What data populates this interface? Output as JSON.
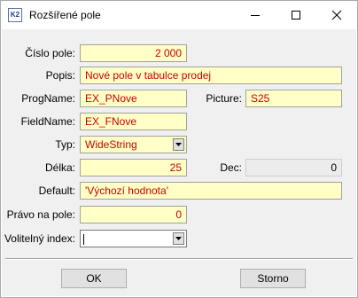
{
  "window": {
    "title": "Rozšířené pole",
    "app_icon_text": "K2"
  },
  "form": {
    "cislo_pole": {
      "label": "Číslo pole:",
      "value": "2 000"
    },
    "popis": {
      "label": "Popis:",
      "value": "Nové pole v tabulce prodej"
    },
    "progname": {
      "label": "ProgName:",
      "value": "EX_PNove"
    },
    "picture": {
      "label": "Picture:",
      "value": "S25"
    },
    "fieldname": {
      "label": "FieldName:",
      "value": "EX_FNove"
    },
    "typ": {
      "label": "Typ:",
      "value": "WideString"
    },
    "delka": {
      "label": "Délka:",
      "value": "25"
    },
    "dec": {
      "label": "Dec:",
      "value": "0"
    },
    "default": {
      "label": "Default:",
      "value": "'Výchozí hodnota'"
    },
    "pravo": {
      "label": "Právo na pole:",
      "value": "0"
    },
    "volitelny_index": {
      "label": "Volitelný index:",
      "value": ""
    }
  },
  "buttons": {
    "ok": "OK",
    "storno": "Storno"
  },
  "colors": {
    "field_background": "#ffffc6",
    "field_text": "#cc0000",
    "disabled_background": "#ececec"
  }
}
